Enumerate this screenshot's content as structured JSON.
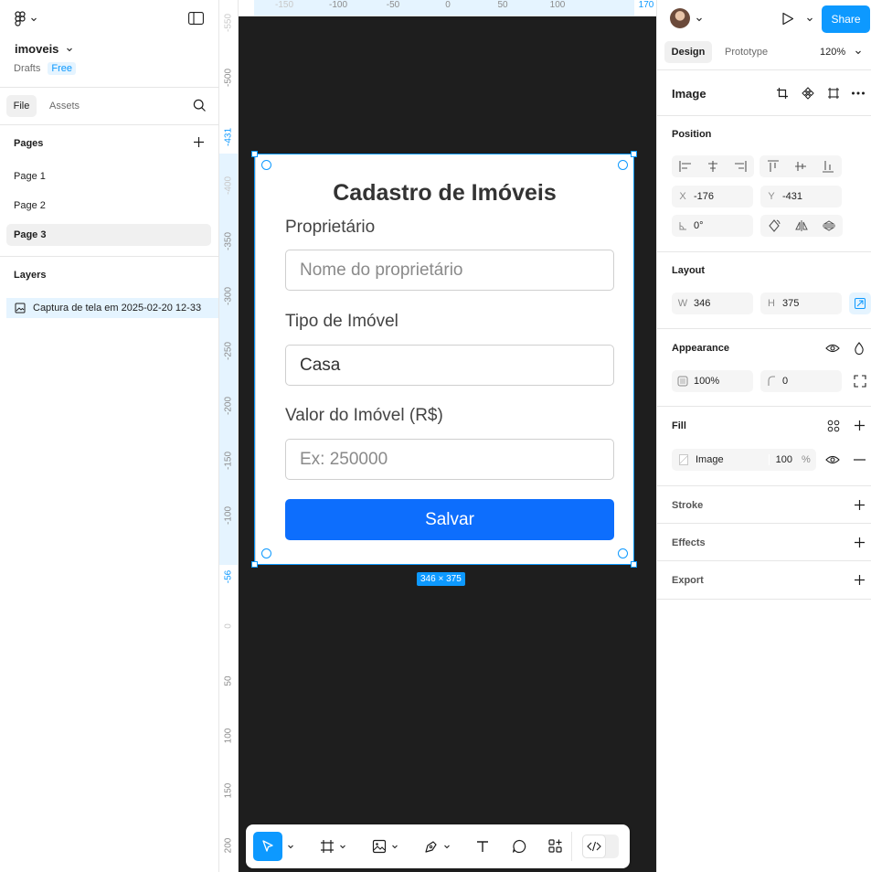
{
  "left_panel": {
    "project_name": "imoveis",
    "drafts_label": "Drafts",
    "plan_badge": "Free",
    "tabs": {
      "file": "File",
      "assets": "Assets"
    },
    "pages_title": "Pages",
    "pages": [
      "Page 1",
      "Page 2",
      "Page 3"
    ],
    "active_page": "Page 3",
    "layers_title": "Layers",
    "layer_name": "Captura de tela em 2025-02-20 12-33"
  },
  "rulers": {
    "top": [
      "-150",
      "-100",
      "-50",
      "0",
      "50",
      "100",
      "170"
    ],
    "left": [
      "-550",
      "-500",
      "-431",
      "-400",
      "-350",
      "-300",
      "-250",
      "-200",
      "-150",
      "-100",
      "-56",
      "0",
      "50",
      "100",
      "150",
      "200"
    ]
  },
  "canvas": {
    "dimension_badge": "346 × 375",
    "form": {
      "title": "Cadastro de Imóveis",
      "owner_label": "Proprietário",
      "owner_placeholder": "Nome do proprietário",
      "type_label": "Tipo de Imóvel",
      "type_value": "Casa",
      "value_label": "Valor do Imóvel (R$)",
      "value_placeholder": "Ex: 250000",
      "save_button": "Salvar"
    }
  },
  "help_label": "?",
  "right_panel": {
    "share_label": "Share",
    "tabs": {
      "design": "Design",
      "prototype": "Prototype"
    },
    "zoom": "120%",
    "selection_title": "Image",
    "position": {
      "title": "Position",
      "x_key": "X",
      "x": "-176",
      "y_key": "Y",
      "y": "-431",
      "rotation": "0°"
    },
    "layout": {
      "title": "Layout",
      "w_key": "W",
      "w": "346",
      "h_key": "H",
      "h": "375"
    },
    "appearance": {
      "title": "Appearance",
      "opacity": "100%",
      "radius": "0"
    },
    "fill": {
      "title": "Fill",
      "type": "Image",
      "opacity": "100",
      "unit": "%"
    },
    "stroke_title": "Stroke",
    "effects_title": "Effects",
    "export_title": "Export"
  },
  "colors": {
    "accent": "#0d99ff",
    "button_blue": "#0d6efd",
    "canvas_bg": "#1e1e1e"
  }
}
